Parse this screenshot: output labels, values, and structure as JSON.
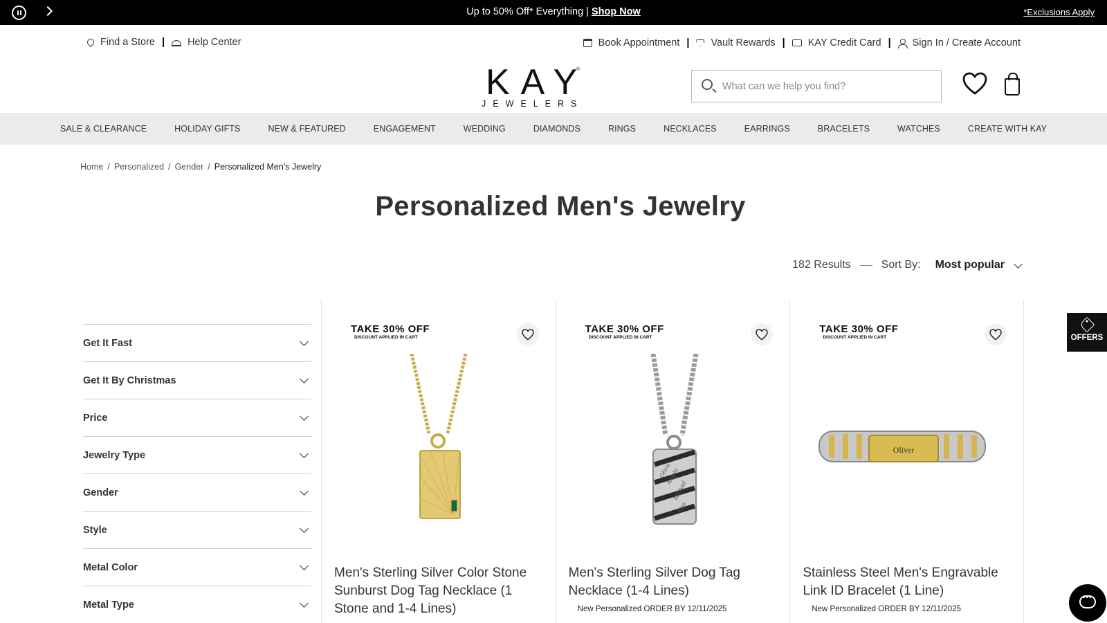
{
  "promo": {
    "message": "Up to 50% Off* Everything | ",
    "link": "Shop Now",
    "exclusions": "*Exclusions Apply"
  },
  "utility_left": [
    {
      "label": "Find a Store",
      "icon": "location-pin-icon"
    },
    {
      "label": "Help Center",
      "icon": "service-bell-icon"
    }
  ],
  "utility_right": [
    {
      "label": "Book Appointment",
      "icon": "calendar-icon"
    },
    {
      "label": "Vault Rewards",
      "icon": "diamond-icon"
    },
    {
      "label": "KAY Credit Card",
      "icon": "credit-card-icon"
    },
    {
      "label": "Sign In / Create Account",
      "icon": "user-icon"
    }
  ],
  "logo": {
    "main": "KAY",
    "sub": "JEWELERS",
    "reg": "®"
  },
  "search": {
    "placeholder": "What can we help you find?",
    "value": ""
  },
  "nav": [
    "SALE & CLEARANCE",
    "HOLIDAY GIFTS",
    "NEW & FEATURED",
    "ENGAGEMENT",
    "WEDDING",
    "DIAMONDS",
    "RINGS",
    "NECKLACES",
    "EARRINGS",
    "BRACELETS",
    "WATCHES",
    "CREATE WITH KAY"
  ],
  "breadcrumb": [
    "Home",
    "Personalized",
    "Gender",
    "Personalized Men's Jewelry"
  ],
  "page_title": "Personalized Men's Jewelry",
  "results": {
    "count": "182 Results",
    "sort_label": "Sort By:",
    "sort_value": "Most popular"
  },
  "filters": [
    "Get It Fast",
    "Get It By Christmas",
    "Price",
    "Jewelry Type",
    "Gender",
    "Style",
    "Metal Color",
    "Metal Type"
  ],
  "products": [
    {
      "badge_main": "TAKE 30% OFF",
      "badge_sub": "DISCOUNT APPLIED IN CART",
      "name": "Men's Sterling Silver Color Stone Sunburst Dog Tag Necklace (1 Stone and 1-4 Lines)",
      "meta": "",
      "image": "gold-dog-tag-necklace"
    },
    {
      "badge_main": "TAKE 30% OFF",
      "badge_sub": "DISCOUNT APPLIED IN CART",
      "name": "Men's Sterling Silver Dog Tag Necklace (1-4 Lines)",
      "meta": "New Personalized ORDER BY 12/11/2025",
      "image": "silver-dog-tag-necklace",
      "engraving": [
        "Olivia",
        "Angela",
        "Michael",
        "Lisa"
      ]
    },
    {
      "badge_main": "TAKE 30% OFF",
      "badge_sub": "DISCOUNT APPLIED IN CART",
      "name": "Stainless Steel Men's Engravable Link ID Bracelet (1 Line)",
      "meta": "New Personalized ORDER BY 12/11/2025",
      "image": "two-tone-id-bracelet",
      "engraving": [
        "Oliver"
      ]
    }
  ],
  "offers_label": "OFFERS",
  "colors": {
    "promo_bg": "#000000",
    "nav_bg": "#ebebeb",
    "gold": "#d9bf62",
    "silver": "#c9c9c9"
  }
}
